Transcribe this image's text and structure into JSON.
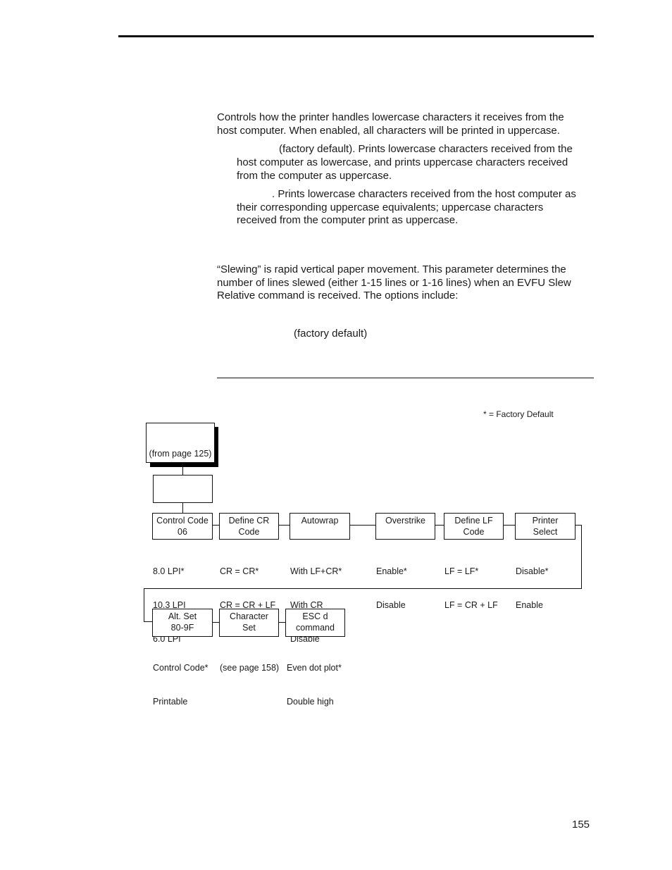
{
  "page": {
    "number": "155"
  },
  "case_section": {
    "description_line1": "Controls how the printer handles lowercase characters it receives from the",
    "description_line2": "host computer. When enabled, all characters will be printed in uppercase.",
    "option1": {
      "line1": "(factory default). Prints lowercase characters received from the",
      "line2": "host computer as lowercase, and prints uppercase characters received",
      "line3": "from the computer as uppercase."
    },
    "option2": {
      "line1": ". Prints lowercase characters received from the host computer as",
      "line2": "their corresponding uppercase equivalents; uppercase characters",
      "line3": "received from the computer print as uppercase."
    }
  },
  "slew_section": {
    "line1": "“Slewing” is rapid vertical paper movement. This parameter determines the",
    "line2": "number of lines slewed (either 1-15 lines or 1-16 lines) when an EVFU Slew",
    "line3": "Relative command is received. The options include:",
    "default_note": "(factory default)"
  },
  "diagram": {
    "legend": "* = Factory Default",
    "entry_box_label": "(from page 125)",
    "row1": [
      {
        "title1": "Control Code",
        "title2": "06",
        "options": [
          "8.0 LPI*",
          "10.3 LPI",
          "6.0 LPI"
        ]
      },
      {
        "title1": "Define CR",
        "title2": "Code",
        "options": [
          "CR = CR*",
          "CR = CR + LF"
        ]
      },
      {
        "title1": "Autowrap",
        "title2": "",
        "options": [
          "With LF+CR*",
          "With CR",
          "Disable"
        ]
      },
      {
        "title1": "Overstrike",
        "title2": "",
        "options": [
          "Enable*",
          "Disable"
        ]
      },
      {
        "title1": "Define LF",
        "title2": "Code",
        "options": [
          "LF = LF*",
          "LF = CR + LF"
        ]
      },
      {
        "title1": "Printer",
        "title2": "Select",
        "options": [
          "Disable*",
          "Enable"
        ]
      }
    ],
    "row2": [
      {
        "title1": "Alt. Set",
        "title2": "80-9F",
        "options": [
          "Control Code*",
          "Printable"
        ]
      },
      {
        "title1": "Character",
        "title2": "Set",
        "options": [
          "(see page 158)"
        ]
      },
      {
        "title1": "ESC d",
        "title2": "command",
        "options": [
          "Even dot plot*",
          "Double high"
        ]
      }
    ]
  }
}
